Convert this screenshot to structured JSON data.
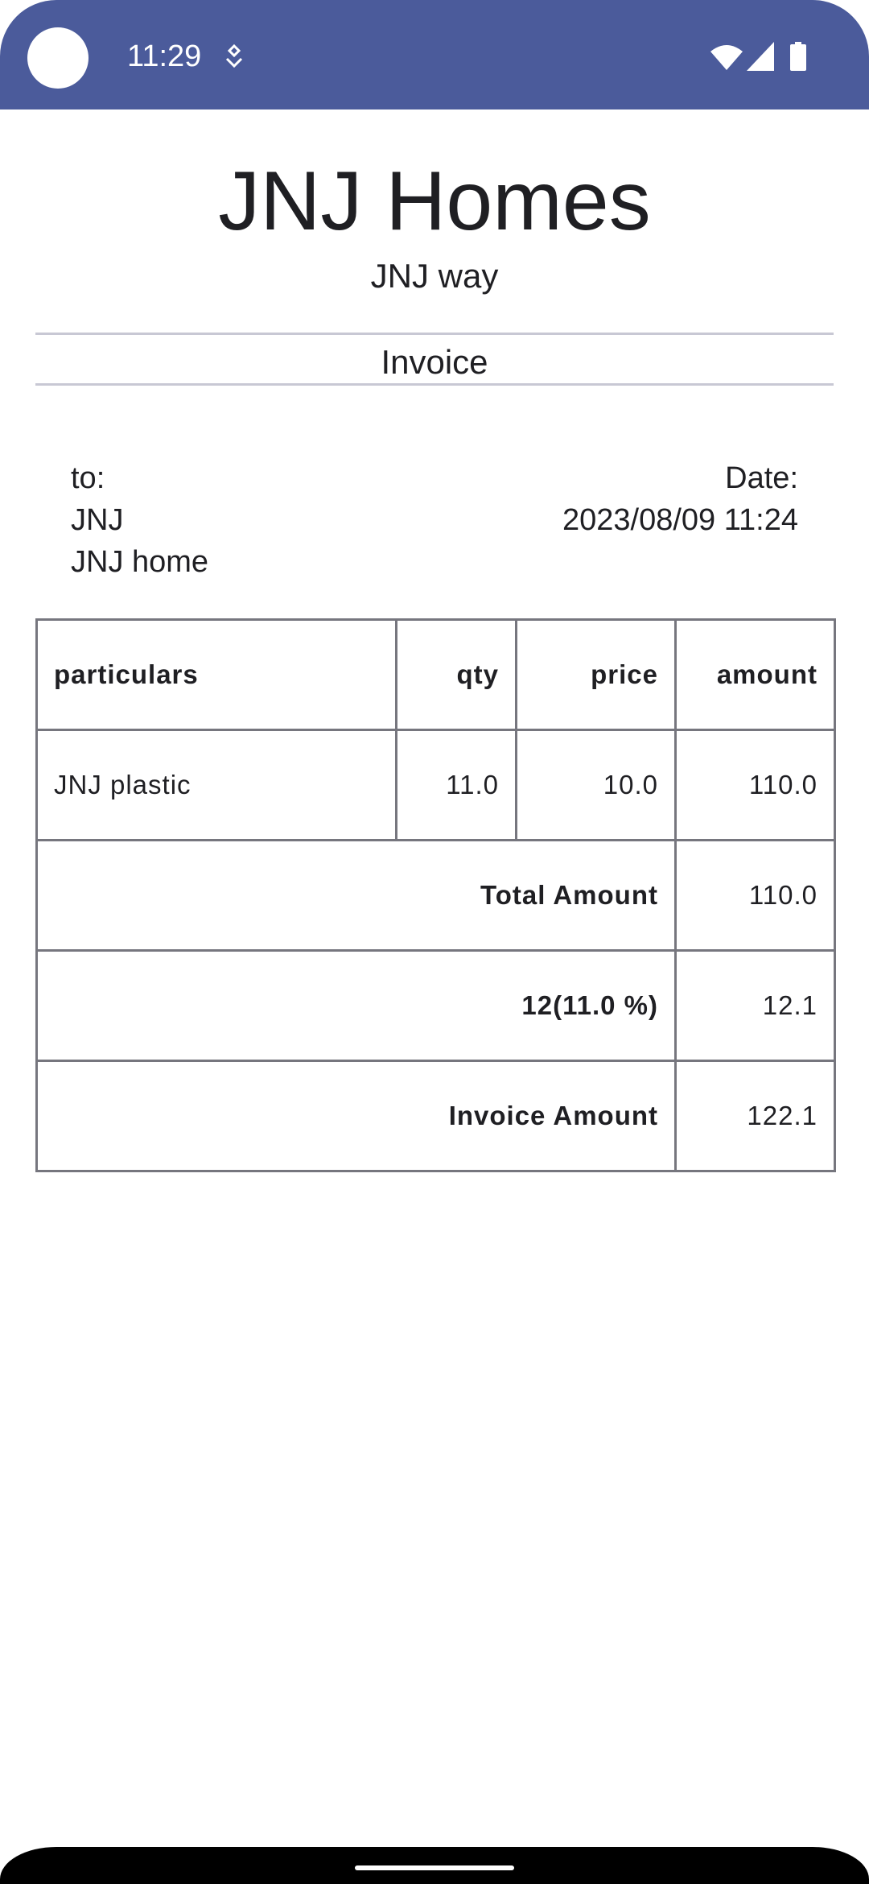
{
  "status_bar": {
    "time": "11:29",
    "icons": [
      "notification-icon",
      "wifi-icon",
      "signal-icon",
      "battery-icon"
    ],
    "color": "#4b5b9b"
  },
  "header": {
    "company_name": "JNJ Homes",
    "tagline": "JNJ way",
    "document_title": "Invoice"
  },
  "bill_to": {
    "label": "to:",
    "name": "JNJ",
    "address": "JNJ home"
  },
  "date": {
    "label": "Date:",
    "value": "2023/08/09 11:24"
  },
  "table": {
    "columns": [
      "particulars",
      "qty",
      "price",
      "amount"
    ],
    "rows": [
      {
        "particulars": "JNJ plastic",
        "qty": "11.0",
        "price": "10.0",
        "amount": "110.0"
      }
    ],
    "total_label": "Total Amount",
    "total_value": "110.0",
    "tax_label": "12(11.0 %)",
    "tax_value": "12.1",
    "invoice_label": "Invoice Amount",
    "invoice_value": "122.1"
  }
}
